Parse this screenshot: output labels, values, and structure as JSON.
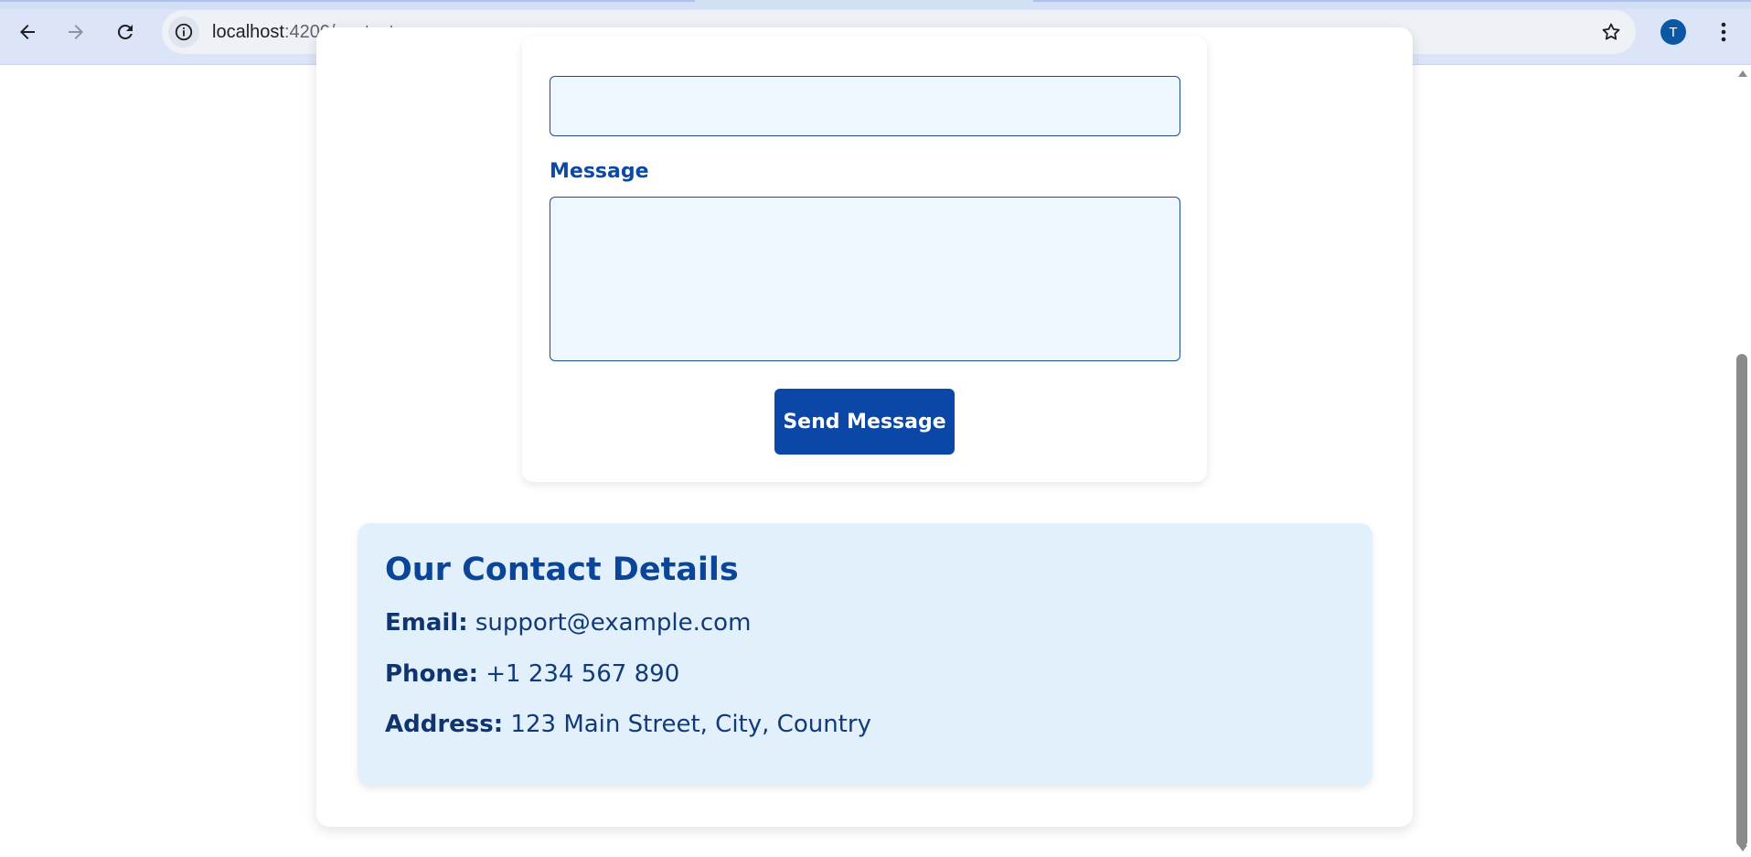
{
  "browser": {
    "url_host": "localhost",
    "url_rest": ":4200/contact",
    "profile_initial": "T"
  },
  "form": {
    "message_label": "Message",
    "send_button_label": "Send Message"
  },
  "contact_details": {
    "title": "Our Contact Details",
    "email_label": "Email:",
    "email_value": "support@example.com",
    "phone_label": "Phone:",
    "phone_value": "+1 234 567 890",
    "address_label": "Address:",
    "address_value": "123 Main Street, City, Country"
  },
  "colors": {
    "brand_blue": "#0a47a6",
    "input_bg": "#eef6fe",
    "details_bg": "#e2f0fb"
  }
}
